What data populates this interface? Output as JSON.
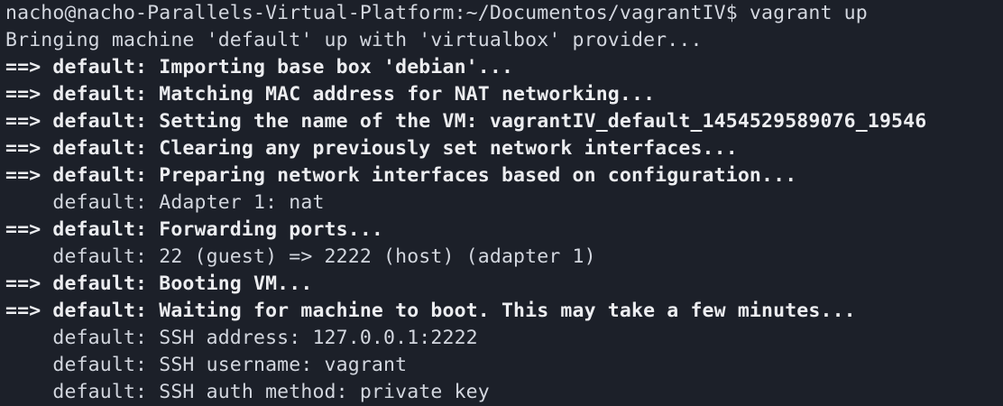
{
  "terminal": {
    "prompt": "nacho@nacho-Parallels-Virtual-Platform:~/Documentos/vagrantIV$ vagrant up",
    "lines": [
      {
        "text": "Bringing machine 'default' up with 'virtualbox' provider...",
        "bold": false
      },
      {
        "text": "==> default: Importing base box 'debian'...",
        "bold": true
      },
      {
        "text": "==> default: Matching MAC address for NAT networking...",
        "bold": true
      },
      {
        "text": "==> default: Setting the name of the VM: vagrantIV_default_1454529589076_19546",
        "bold": true
      },
      {
        "text": "==> default: Clearing any previously set network interfaces...",
        "bold": true
      },
      {
        "text": "==> default: Preparing network interfaces based on configuration...",
        "bold": true
      },
      {
        "text": "    default: Adapter 1: nat",
        "bold": false
      },
      {
        "text": "==> default: Forwarding ports...",
        "bold": true
      },
      {
        "text": "    default: 22 (guest) => 2222 (host) (adapter 1)",
        "bold": false
      },
      {
        "text": "==> default: Booting VM...",
        "bold": true
      },
      {
        "text": "==> default: Waiting for machine to boot. This may take a few minutes...",
        "bold": true
      },
      {
        "text": "    default: SSH address: 127.0.0.1:2222",
        "bold": false
      },
      {
        "text": "    default: SSH username: vagrant",
        "bold": false
      },
      {
        "text": "    default: SSH auth method: private key",
        "bold": false
      }
    ]
  }
}
